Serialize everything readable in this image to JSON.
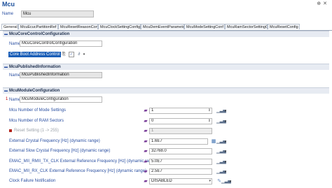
{
  "header": {
    "title": "Mcu",
    "icons": [
      "pin-icon",
      "close-icon"
    ]
  },
  "top": {
    "name_label": "Name",
    "name_value": "Mcu"
  },
  "tabs": [
    {
      "label": "General"
    },
    {
      "label": "McuEcucPartitionRef"
    },
    {
      "label": "McuResetReasonConf"
    },
    {
      "label": "McuClockSettingConfig"
    },
    {
      "label": "McuDemEventParameter"
    },
    {
      "label": "McuModeSettingConf"
    },
    {
      "label": "McuRamSectorSettingC"
    },
    {
      "label": "McuResetConfig"
    }
  ],
  "sections": {
    "core": {
      "title": "McuCoreControlConfiguration",
      "name_label": "Name",
      "name_value": "McuCoreControlConfiguration",
      "boot_label": "Core Boot Address Control"
    },
    "published": {
      "title": "McuPublishedInformation",
      "name_label": "Name",
      "name_value": "McuPublishedInformation"
    },
    "module": {
      "title": "McuModuleConfiguration",
      "name_label": "Name",
      "name_value": "McuModuleConfiguration",
      "required_mark": "1",
      "rows": [
        {
          "label": "Mcu Number of Mode Settings",
          "value": "1"
        },
        {
          "label": "Mcu Number of RAM Sectors",
          "value": "0"
        },
        {
          "label": "Reset Setting (1 -> 255)",
          "value": "1"
        },
        {
          "label": "External Crystal Frequency [Hz] (dynamic range)",
          "value": "1.6E7"
        },
        {
          "label": "External Slow Crystal Frequency [Hz] (dynamic range)",
          "value": "32768.0"
        },
        {
          "label": "EMAC_MII_RMII_TX_CLK External Reference Frequency [Hz] (dynamic range)",
          "value": "5.0E7"
        },
        {
          "label": "EMAC_MII_RX_CLK External Reference Frequency [Hz] (dynamic range)",
          "value": "2.5E7"
        },
        {
          "label": "Clock Failure Notification",
          "value": "DISABLED"
        }
      ]
    }
  }
}
